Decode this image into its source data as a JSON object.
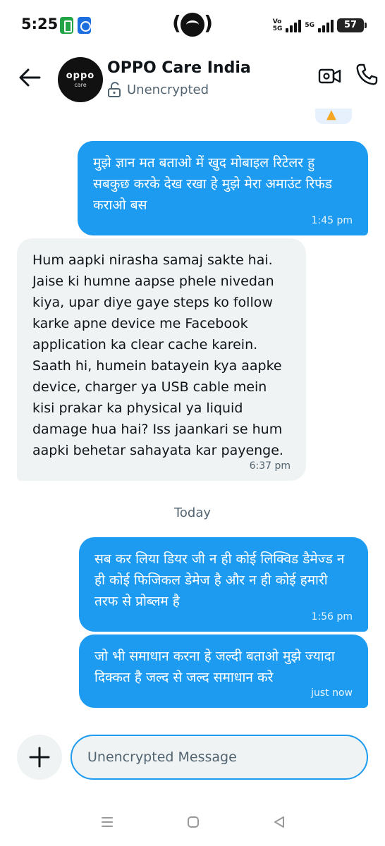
{
  "status_bar": {
    "time": "5:25",
    "volte_top": "Vo",
    "volte_bottom": "5G",
    "network_label": "5G",
    "battery": "57"
  },
  "header": {
    "contact_name": "OPPO Care India",
    "avatar_brand": "oppo",
    "avatar_sub": "care",
    "encryption_label": "Unencrypted"
  },
  "messages": [
    {
      "direction": "out",
      "text": "मुझे ज्ञान मत बताओ में खुद मोबाइल रिटेलर हु सबकुछ करके देख रखा हे मुझे मेरा अमाउंट रिफंड कराओ बस",
      "time": "1:45 pm"
    },
    {
      "direction": "in",
      "text": "Hum aapki nirasha samaj sakte hai. Jaise ki humne aapse phele nivedan kiya, upar diye gaye steps ko follow karke apne device me Facebook application ka clear cache karein. Saath hi, humein batayein kya aapke device, charger ya USB cable mein kisi prakar ka physical ya liquid damage hua hai? Iss jaankari se hum aapki behetar sahayata kar payenge.",
      "time": "6:37 pm"
    },
    {
      "direction": "out",
      "text": "सब कर लिया डियर जी न ही कोई लिक्विड डैमेज्ड न ही कोई फिजिकल डेमेज है और न ही कोई हमारी तरफ से प्रोब्लम है",
      "time": "1:56 pm"
    },
    {
      "direction": "out",
      "text": "जो भी समाधान करना हे जल्दी बताओ मुझे ज्यादा दिक्कत है जल्द से जल्द समाधान करे",
      "time": "just now"
    }
  ],
  "day_separator": "Today",
  "composer": {
    "placeholder": "Unencrypted Message"
  },
  "colors": {
    "outgoing_bubble": "#1d9bf0",
    "incoming_bubble": "#eff3f4",
    "secondary_text": "#536471"
  },
  "icons": {
    "back": "arrow-left-icon",
    "lock": "unlocked-padlock-icon",
    "video": "video-camera-icon",
    "call": "phone-icon",
    "plus": "plus-icon"
  }
}
